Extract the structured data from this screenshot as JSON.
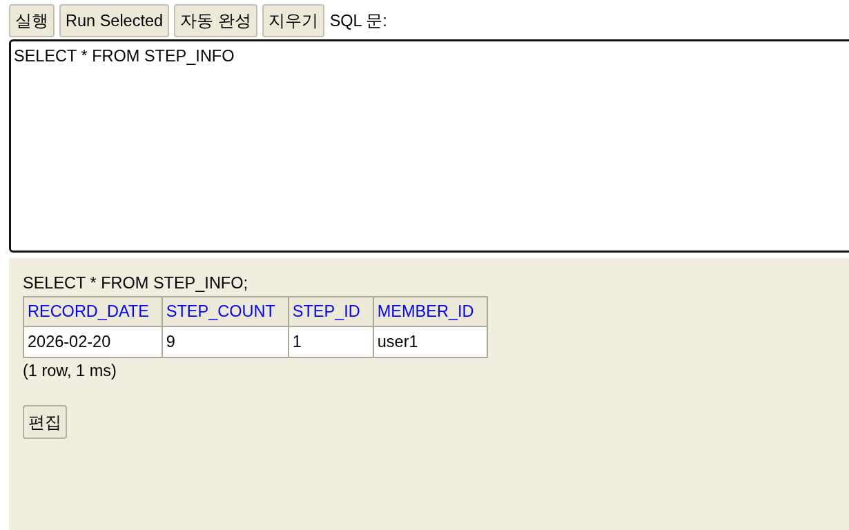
{
  "toolbar": {
    "buttons": [
      {
        "label": "실행"
      },
      {
        "label": "Run Selected"
      },
      {
        "label": "자동 완성"
      },
      {
        "label": "지우기"
      }
    ],
    "label": "SQL 문:"
  },
  "editor": {
    "value": "SELECT * FROM STEP_INFO"
  },
  "result": {
    "statement": "SELECT * FROM STEP_INFO;",
    "table": {
      "columns": [
        "RECORD_DATE",
        "STEP_COUNT",
        "STEP_ID",
        "MEMBER_ID"
      ],
      "rows": [
        [
          "2026-02-20",
          "9",
          "1",
          "user1"
        ]
      ]
    },
    "summary": "(1 row, 1 ms)",
    "buttons": [
      {
        "label": "편집"
      }
    ]
  }
}
